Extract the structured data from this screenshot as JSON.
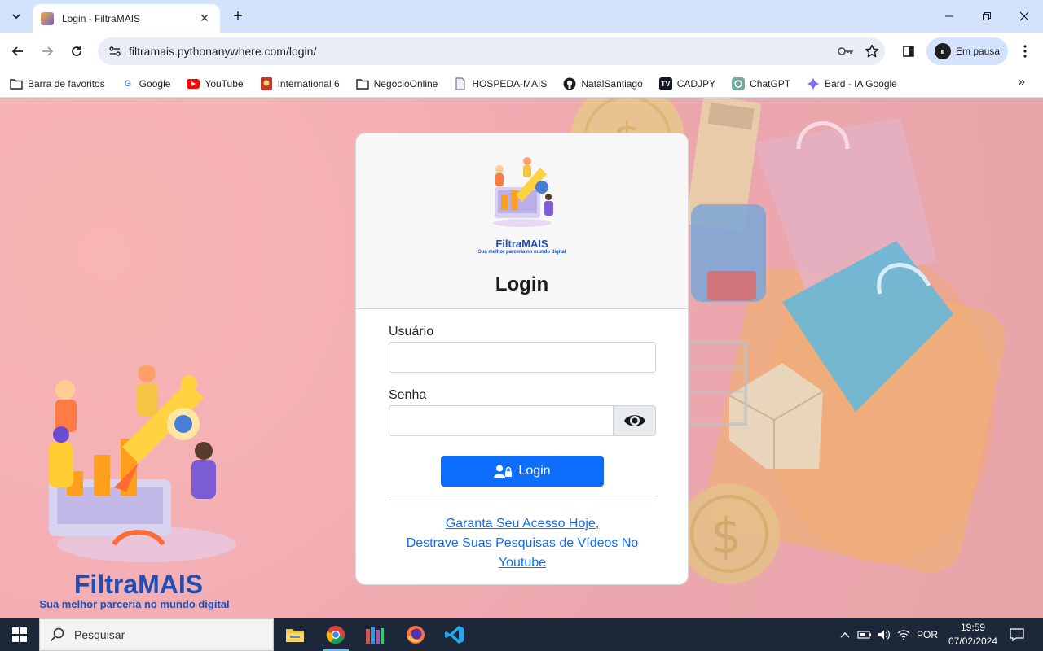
{
  "browser": {
    "tab_title": "Login - FiltraMAIS",
    "url": "filtramais.pythonanywhere.com/login/",
    "profile_label": "Em pausa",
    "bookmarks": [
      {
        "label": "Barra de favoritos",
        "icon": "folder-icon"
      },
      {
        "label": "Google",
        "icon": "google-icon"
      },
      {
        "label": "YouTube",
        "icon": "youtube-icon"
      },
      {
        "label": "International 6",
        "icon": "international-icon"
      },
      {
        "label": "NegocioOnline",
        "icon": "folder-icon"
      },
      {
        "label": "HOSPEDA-MAIS",
        "icon": "document-icon"
      },
      {
        "label": "NatalSantiago",
        "icon": "github-icon"
      },
      {
        "label": "CADJPY",
        "icon": "tradingview-icon"
      },
      {
        "label": "ChatGPT",
        "icon": "chatgpt-icon"
      },
      {
        "label": "Bard - IA Google",
        "icon": "bard-icon"
      }
    ]
  },
  "login": {
    "brand_name": "FiltraMAIS",
    "brand_tagline": "Sua melhor parceria no mundo digital",
    "title": "Login",
    "user_label": "Usuário",
    "user_value": "",
    "password_label": "Senha",
    "password_value": "",
    "submit_label": "Login",
    "link_line1": "Garanta Seu Acesso Hoje,",
    "link_line2": "Destrave Suas Pesquisas de Vídeos No",
    "link_line3": "Youtube"
  },
  "background_brand": {
    "name": "FiltraMAIS",
    "tagline": "Sua melhor parceria no mundo digital"
  },
  "taskbar": {
    "search_placeholder": "Pesquisar",
    "language": "POR",
    "time": "19:59",
    "date": "07/02/2024"
  },
  "colors": {
    "primary": "#0d6efd",
    "brand_blue": "#1f4fb5",
    "page_bg": "#f2b2b4",
    "taskbar": "#1c2839"
  }
}
